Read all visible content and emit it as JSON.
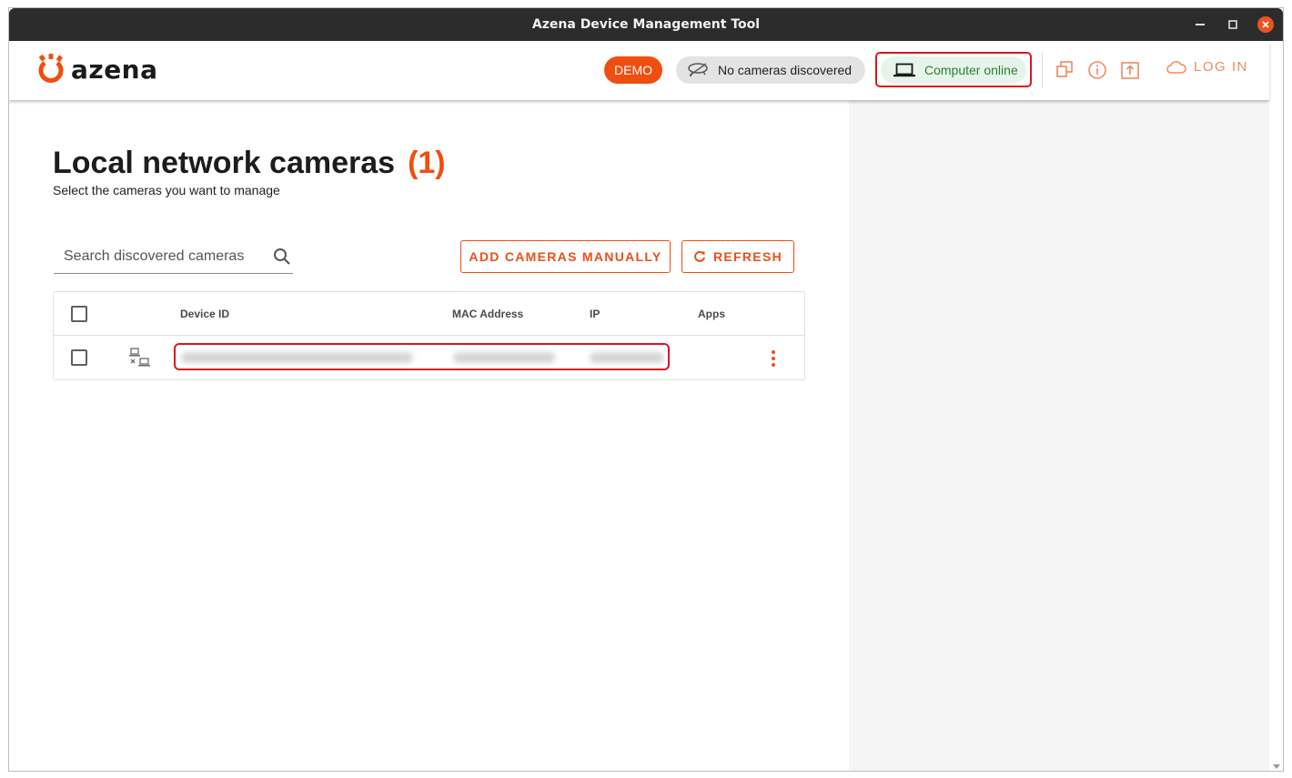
{
  "window": {
    "title": "Azena Device Management Tool"
  },
  "header": {
    "logo_text": "azena",
    "demo_label": "DEMO",
    "cameras_status": "No cameras discovered",
    "computer_status": "Computer online",
    "login_label": "LOG IN",
    "icons": [
      "windows-icon",
      "info-icon",
      "upload-icon",
      "cloud-icon"
    ]
  },
  "main": {
    "title": "Local network cameras",
    "count": "(1)",
    "subtitle": "Select the cameras you want to manage",
    "search": {
      "placeholder": "Search discovered cameras"
    },
    "add_button": "ADD CAMERAS MANUALLY",
    "refresh_button": "REFRESH"
  },
  "table": {
    "columns": {
      "device_id": "Device ID",
      "mac": "MAC Address",
      "ip": "IP",
      "apps": "Apps"
    },
    "rows": [
      {
        "device_id": "",
        "mac": "",
        "ip": "",
        "apps": "",
        "status_icon": "camera-offline-icon"
      }
    ]
  },
  "colors": {
    "accent": "#f04e0f",
    "online": "#2e7d32",
    "highlight": "#e0141e"
  }
}
